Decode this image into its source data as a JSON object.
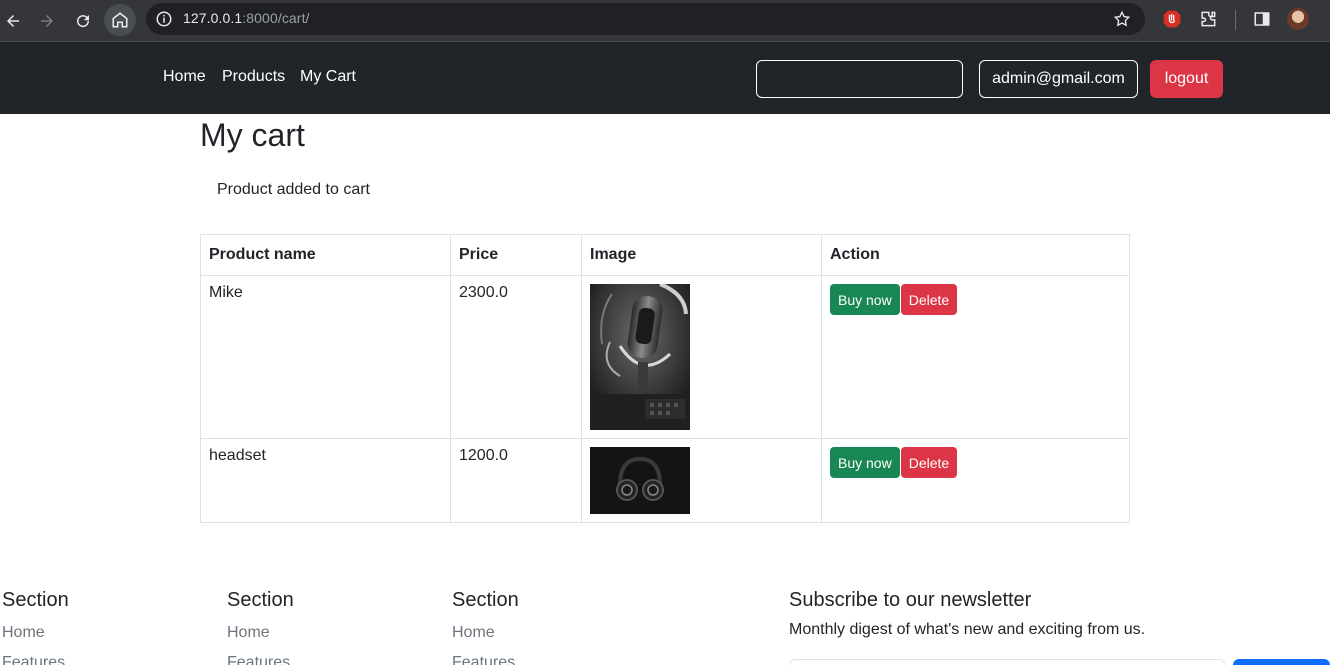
{
  "browser": {
    "url_host": "127.0.0.1",
    "url_rest": ":8000/cart/"
  },
  "navbar": {
    "links": [
      "Home",
      "Products",
      "My Cart"
    ],
    "search_value": "",
    "user_email": "admin@gmail.com",
    "logout_label": "logout",
    "background": "#212529",
    "danger_color": "#dc3545"
  },
  "page": {
    "title": "My cart",
    "message": "Product added to cart"
  },
  "cart": {
    "headers": [
      "Product name",
      "Price",
      "Image",
      "Action"
    ],
    "rows": [
      {
        "name": "Mike",
        "price": "2300.0",
        "image_icon": "microphone-photo",
        "buy_label": "Buy now",
        "delete_label": "Delete"
      },
      {
        "name": "headset",
        "price": "1200.0",
        "image_icon": "headphones-photo",
        "buy_label": "Buy now",
        "delete_label": "Delete"
      }
    ],
    "buy_color": "#198754"
  },
  "footer": {
    "sections": [
      {
        "title": "Section",
        "links": [
          "Home",
          "Features"
        ]
      },
      {
        "title": "Section",
        "links": [
          "Home",
          "Features"
        ]
      },
      {
        "title": "Section",
        "links": [
          "Home",
          "Features"
        ]
      }
    ],
    "newsletter": {
      "title": "Subscribe to our newsletter",
      "text": "Monthly digest of what's new and exciting from us.",
      "button_color": "#0d6efd"
    }
  }
}
